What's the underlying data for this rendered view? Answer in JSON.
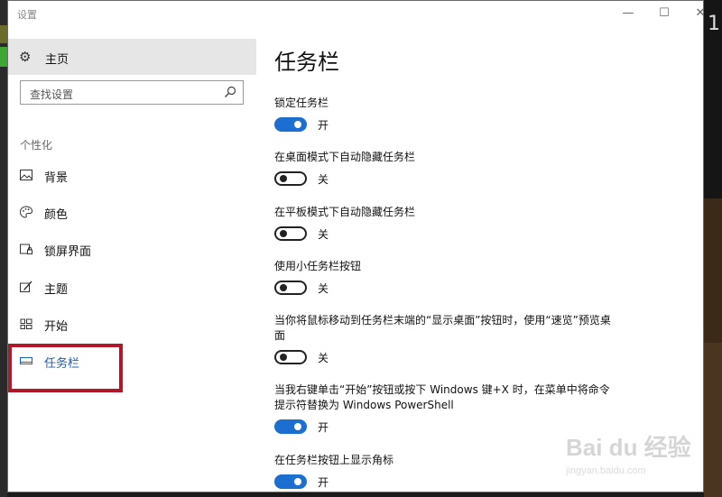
{
  "window": {
    "title": "设置"
  },
  "sidebar": {
    "home_label": "主页",
    "search_placeholder": "查找设置",
    "section_label": "个性化",
    "items": [
      {
        "label": "背景",
        "icon": "image-icon"
      },
      {
        "label": "颜色",
        "icon": "palette-icon"
      },
      {
        "label": "锁屏界面",
        "icon": "lockscreen-icon"
      },
      {
        "label": "主题",
        "icon": "theme-brush-icon"
      },
      {
        "label": "开始",
        "icon": "start-grid-icon"
      },
      {
        "label": "任务栏",
        "icon": "taskbar-icon",
        "active": true
      }
    ]
  },
  "content": {
    "title": "任务栏",
    "settings": [
      {
        "label": "锁定任务栏",
        "state": "开",
        "on": true
      },
      {
        "label": "在桌面模式下自动隐藏任务栏",
        "state": "关",
        "on": false
      },
      {
        "label": "在平板模式下自动隐藏任务栏",
        "state": "关",
        "on": false
      },
      {
        "label": "使用小任务栏按钮",
        "state": "关",
        "on": false
      },
      {
        "label": "当你将鼠标移动到任务栏末端的“显示桌面”按钮时，使用“速览”预览桌面",
        "state": "关",
        "on": false
      },
      {
        "label": "当我右键单击“开始”按钮或按下 Windows 键+X 时，在菜单中将命令提示符替换为 Windows PowerShell",
        "state": "开",
        "on": true
      },
      {
        "label": "在任务栏按钮上显示角标",
        "state": "开",
        "on": true
      }
    ]
  },
  "watermark": {
    "text": "Bai du 经验",
    "sub": "jingyan.baidu.com"
  },
  "colors": {
    "accent": "#1c6fd0",
    "highlight_box": "#b0182a",
    "active_nav": "#1a5fb4"
  }
}
